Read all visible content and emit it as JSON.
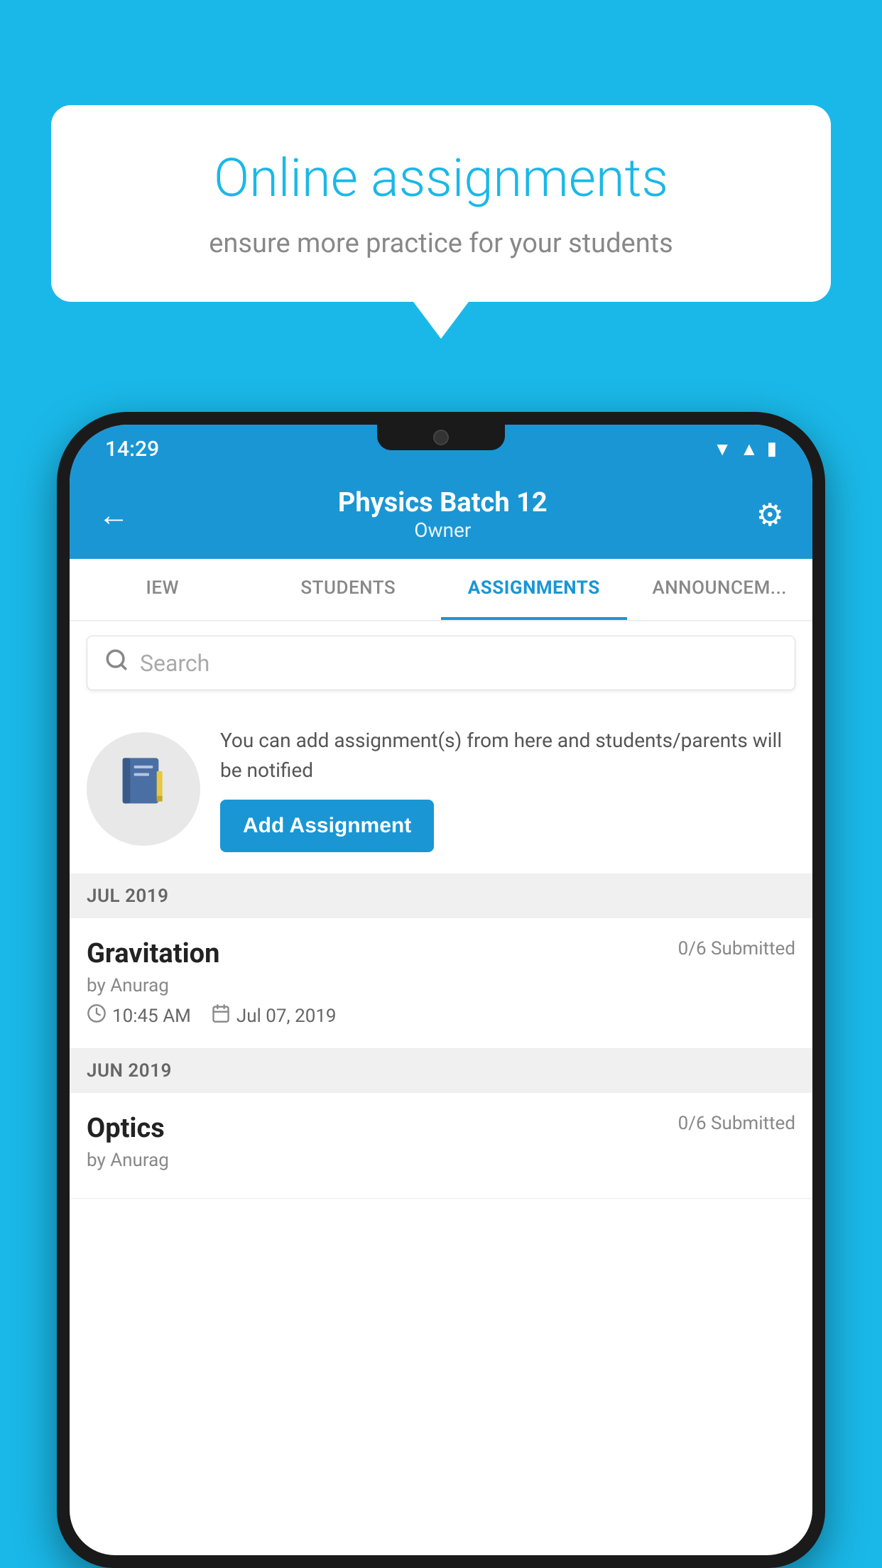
{
  "background_color": "#1ab8e8",
  "bubble": {
    "title": "Online assignments",
    "subtitle": "ensure more practice for your students"
  },
  "status_bar": {
    "time": "14:29",
    "wifi": "▼",
    "signal": "▲",
    "battery": "▮"
  },
  "header": {
    "title": "Physics Batch 12",
    "subtitle": "Owner",
    "back_label": "←",
    "settings_label": "⚙"
  },
  "tabs": [
    {
      "id": "view",
      "label": "IEW"
    },
    {
      "id": "students",
      "label": "STUDENTS"
    },
    {
      "id": "assignments",
      "label": "ASSIGNMENTS",
      "active": true
    },
    {
      "id": "announcements",
      "label": "ANNOUNCEMENTS"
    }
  ],
  "search": {
    "placeholder": "Search"
  },
  "promo": {
    "icon": "📓",
    "text": "You can add assignment(s) from here and students/parents will be notified",
    "button_label": "Add Assignment"
  },
  "sections": [
    {
      "id": "jul2019",
      "header": "JUL 2019",
      "assignments": [
        {
          "id": "gravitation",
          "name": "Gravitation",
          "status": "0/6 Submitted",
          "author": "by Anurag",
          "time": "10:45 AM",
          "date": "Jul 07, 2019"
        }
      ]
    },
    {
      "id": "jun2019",
      "header": "JUN 2019",
      "assignments": [
        {
          "id": "optics",
          "name": "Optics",
          "status": "0/6 Submitted",
          "author": "by Anurag",
          "time": "",
          "date": ""
        }
      ]
    }
  ]
}
